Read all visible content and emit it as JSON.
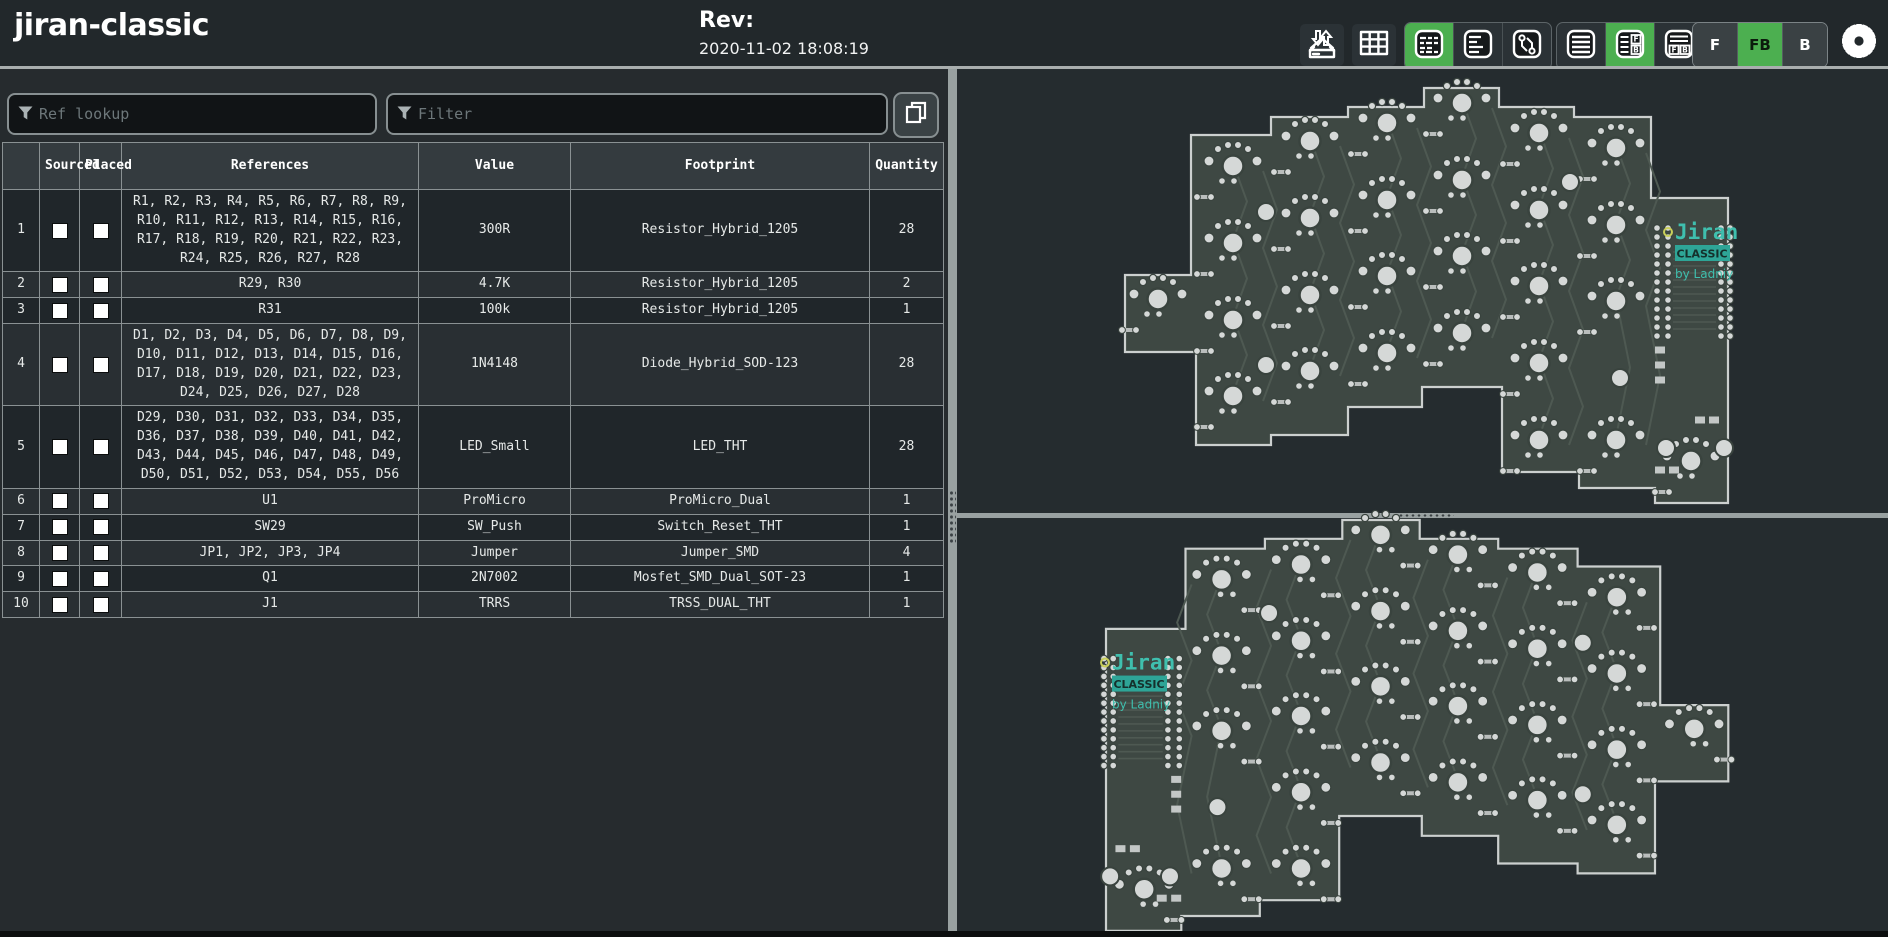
{
  "header": {
    "title": "jiran-classic",
    "rev_label": "Rev:",
    "rev_date": "2020-11-02 18:08:19"
  },
  "toolbar": {
    "icons": [
      {
        "name": "import-export-icon",
        "active": false
      },
      {
        "name": "stats-table-icon",
        "active": false
      },
      {
        "name": "bom-grouped-icon",
        "active": true
      },
      {
        "name": "bom-ungrouped-icon",
        "active": false
      },
      {
        "name": "bom-netlist-icon",
        "active": false
      },
      {
        "name": "bom-only-layout-icon",
        "active": false
      },
      {
        "name": "split-left-right-layout-icon",
        "active": true
      },
      {
        "name": "split-top-bottom-layout-icon",
        "active": false
      },
      {
        "name": "settings-gear-icon",
        "active": false
      }
    ],
    "view_buttons": {
      "front": "F",
      "front_back": "FB",
      "back": "B",
      "active": "FB"
    },
    "accent_green": "#4caf50"
  },
  "filters": {
    "ref_lookup_placeholder": "Ref lookup",
    "filter_placeholder": "Filter",
    "ref_lookup_value": "",
    "filter_value": ""
  },
  "bom": {
    "columns": [
      "",
      "Sourced",
      "Placed",
      "References",
      "Value",
      "Footprint",
      "Quantity"
    ],
    "rows": [
      {
        "num": "1",
        "sourced": true,
        "placed": true,
        "references": "R1, R2, R3, R4, R5, R6, R7, R8, R9, R10, R11, R12, R13, R14, R15, R16, R17, R18, R19, R20, R21, R22, R23, R24, R25, R26, R27, R28",
        "value": "300R",
        "footprint": "Resistor_Hybrid_1205",
        "quantity": "28"
      },
      {
        "num": "2",
        "sourced": true,
        "placed": true,
        "references": "R29, R30",
        "value": "4.7K",
        "footprint": "Resistor_Hybrid_1205",
        "quantity": "2"
      },
      {
        "num": "3",
        "sourced": true,
        "placed": true,
        "references": "R31",
        "value": "100k",
        "footprint": "Resistor_Hybrid_1205",
        "quantity": "1"
      },
      {
        "num": "4",
        "sourced": true,
        "placed": true,
        "references": "D1, D2, D3, D4, D5, D6, D7, D8, D9, D10, D11, D12, D13, D14, D15, D16, D17, D18, D19, D20, D21, D22, D23, D24, D25, D26, D27, D28",
        "value": "1N4148",
        "footprint": "Diode_Hybrid_SOD-123",
        "quantity": "28"
      },
      {
        "num": "5",
        "sourced": true,
        "placed": true,
        "references": "D29, D30, D31, D32, D33, D34, D35, D36, D37, D38, D39, D40, D41, D42, D43, D44, D45, D46, D47, D48, D49, D50, D51, D52, D53, D54, D55, D56",
        "value": "LED_Small",
        "footprint": "LED_THT",
        "quantity": "28"
      },
      {
        "num": "6",
        "sourced": true,
        "placed": true,
        "references": "U1",
        "value": "ProMicro",
        "footprint": "ProMicro_Dual",
        "quantity": "1"
      },
      {
        "num": "7",
        "sourced": true,
        "placed": true,
        "references": "SW29",
        "value": "SW_Push",
        "footprint": "Switch_Reset_THT",
        "quantity": "1"
      },
      {
        "num": "8",
        "sourced": true,
        "placed": true,
        "references": "JP1, JP2, JP3, JP4",
        "value": "Jumper",
        "footprint": "Jumper_SMD",
        "quantity": "4"
      },
      {
        "num": "9",
        "sourced": true,
        "placed": true,
        "references": "Q1",
        "value": "2N7002",
        "footprint": "Mosfet_SMD_Dual_SOT-23",
        "quantity": "1"
      },
      {
        "num": "10",
        "sourced": true,
        "placed": true,
        "references": "J1",
        "value": "TRRS",
        "footprint": "TRSS_DUAL_THT",
        "quantity": "1"
      }
    ]
  },
  "pcb": {
    "logo": {
      "name": "Jiran",
      "series": "CLASSIC",
      "byline": "by Ladniy"
    },
    "teal": "#3fbfae",
    "board_color": "#3e4843",
    "pad_color": "#d5d8d7",
    "canvas_color": "#252c2f"
  }
}
